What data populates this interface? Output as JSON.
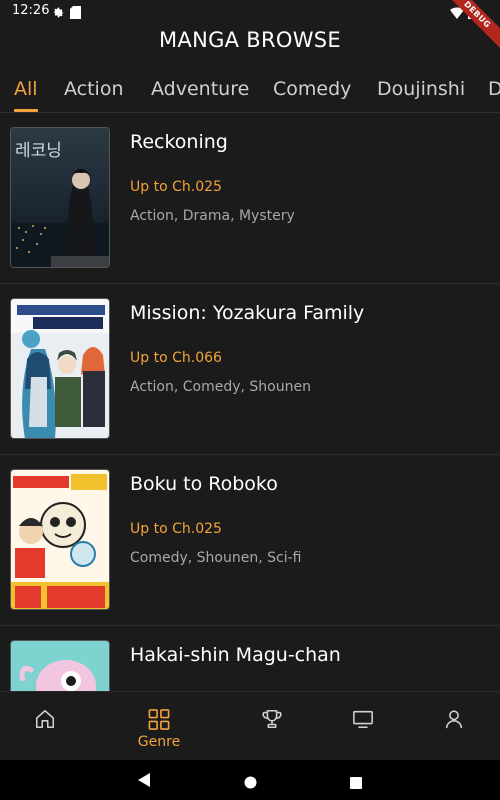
{
  "status_bar": {
    "time": "12:26",
    "icons": [
      "gear-icon",
      "sd-card-icon",
      "wifi-icon",
      "battery-icon"
    ],
    "debug_label": "DEBUG"
  },
  "header": {
    "title": "MANGA BROWSE"
  },
  "tabs": {
    "items": [
      {
        "label": "All",
        "active": true
      },
      {
        "label": "Action",
        "active": false
      },
      {
        "label": "Adventure",
        "active": false
      },
      {
        "label": "Comedy",
        "active": false
      },
      {
        "label": "Doujinshi",
        "active": false
      },
      {
        "label": "D",
        "active": false
      }
    ]
  },
  "manga_list": [
    {
      "title": "Reckoning",
      "chapter": "Up to  Ch.025",
      "genres": "Action, Drama, Mystery",
      "cover_text": "레코닝"
    },
    {
      "title": "Mission: Yozakura Family",
      "chapter": "Up to  Ch.066",
      "genres": "Action, Comedy, Shounen",
      "cover_text": ""
    },
    {
      "title": "Boku to Roboko",
      "chapter": "Up to  Ch.025",
      "genres": "Comedy, Shounen, Sci-fi",
      "cover_text": ""
    },
    {
      "title": "Hakai-shin Magu-chan",
      "chapter": "",
      "genres": "",
      "cover_text": ""
    }
  ],
  "bottom_nav": {
    "items": [
      {
        "icon": "home-icon",
        "label": "",
        "active": false
      },
      {
        "icon": "grid-icon",
        "label": "Genre",
        "active": true
      },
      {
        "icon": "trophy-icon",
        "label": "",
        "active": false
      },
      {
        "icon": "tv-icon",
        "label": "",
        "active": false
      },
      {
        "icon": "person-icon",
        "label": "",
        "active": false
      }
    ]
  },
  "colors": {
    "accent": "#f2a33a",
    "background": "#1b1b1b",
    "text": "#ffffff",
    "secondary_text": "#a8a8a8"
  }
}
